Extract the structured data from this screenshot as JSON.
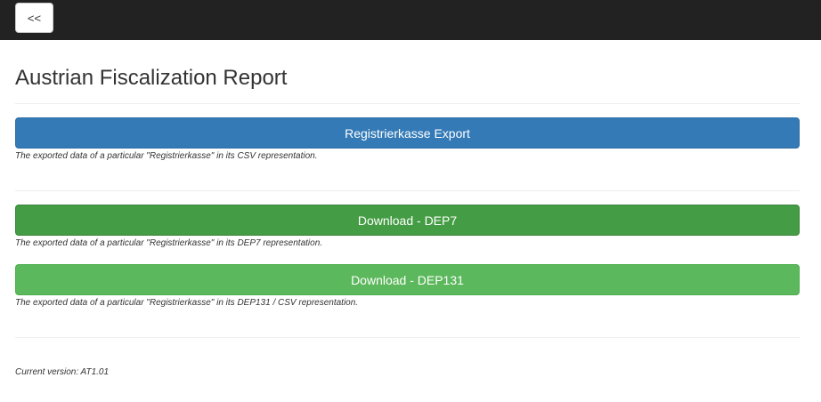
{
  "nav": {
    "back_label": "<<"
  },
  "page": {
    "title": "Austrian Fiscalization Report"
  },
  "actions": [
    {
      "label": "Registrierkasse Export",
      "description": "The exported data of a particular \"Registrierkasse\" in its CSV representation.",
      "color": "#337ab7"
    },
    {
      "label": "Download - DEP7",
      "description": "The exported data of a particular \"Registrierkasse\" in its DEP7 representation.",
      "color": "#449d44"
    },
    {
      "label": "Download - DEP131",
      "description": "The exported data of a particular \"Registrierkasse\" in its DEP131 / CSV representation.",
      "color": "#5cb85c"
    }
  ],
  "footer": {
    "version_text": "Current version: AT1.01"
  }
}
